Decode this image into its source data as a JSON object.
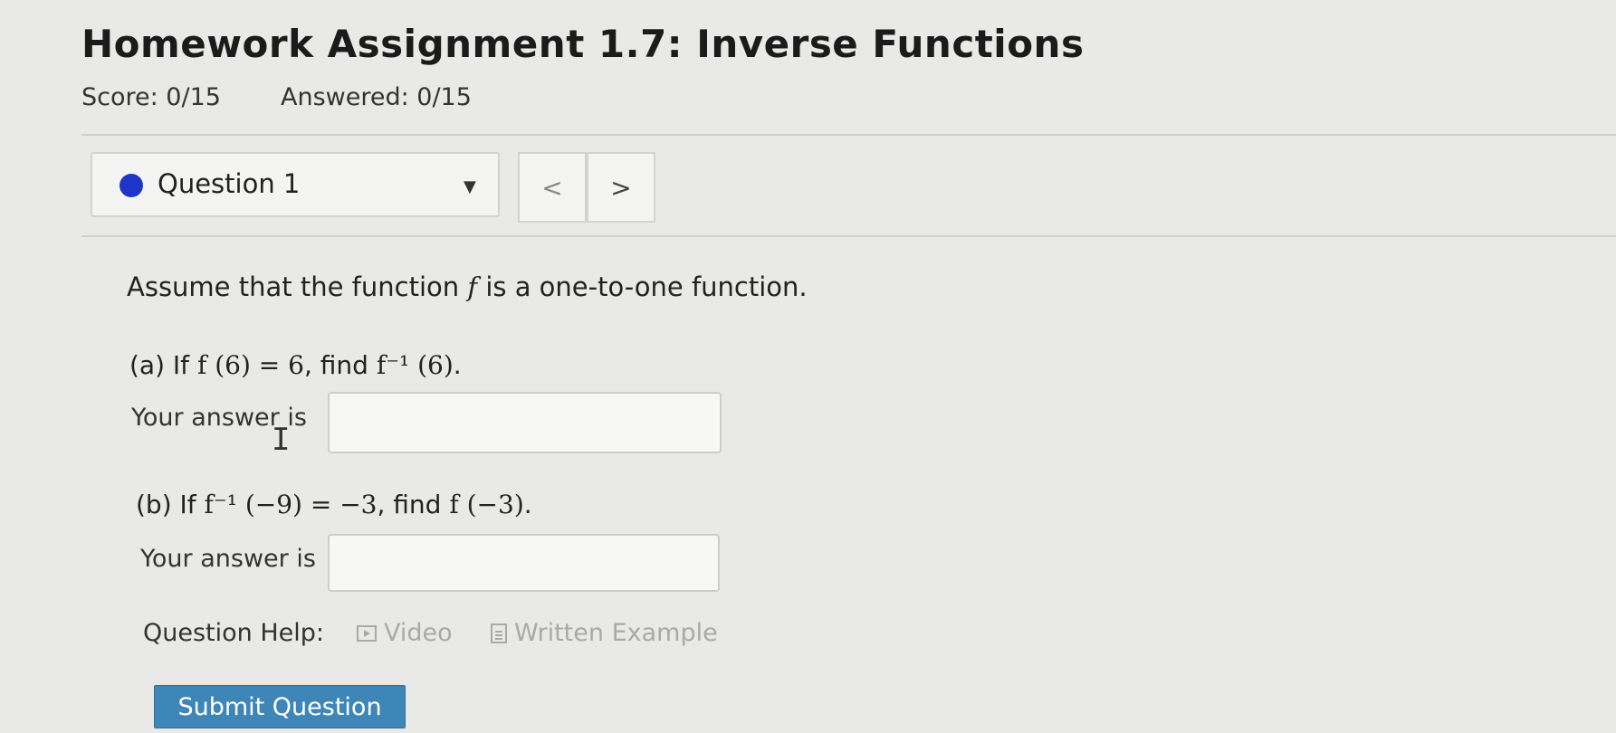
{
  "header": {
    "title": "Homework Assignment 1.7: Inverse Functions",
    "score": "Score: 0/15",
    "answered": "Answered: 0/15"
  },
  "question_nav": {
    "selected": "Question 1",
    "prev": "<",
    "next": ">",
    "status_color": "#1f35c8"
  },
  "question": {
    "statement_pre": "Assume that the function",
    "statement_var": "f",
    "statement_post": "is a one-to-one function.",
    "part_a": {
      "label": "(a) If",
      "given": "f (6) = 6",
      "find_word": ", find",
      "target": "f⁻¹ (6)",
      "end": "."
    },
    "part_b": {
      "label": "(b) If",
      "given": "f⁻¹ (−9) = −3",
      "find_word": ", find",
      "target": "f (−3)",
      "end": "."
    },
    "answer_a_label": "Your answer is",
    "answer_b_label": "Your answer is",
    "answer_a_value": "",
    "answer_b_value": ""
  },
  "help": {
    "label": "Question Help:",
    "video": "Video",
    "written": "Written Example",
    "video_icon": "video-icon",
    "written_icon": "document-icon"
  },
  "submit_label": "Submit Question",
  "colors": {
    "submit_bg": "#3f86b8",
    "link_disabled": "#a9a9a6"
  }
}
